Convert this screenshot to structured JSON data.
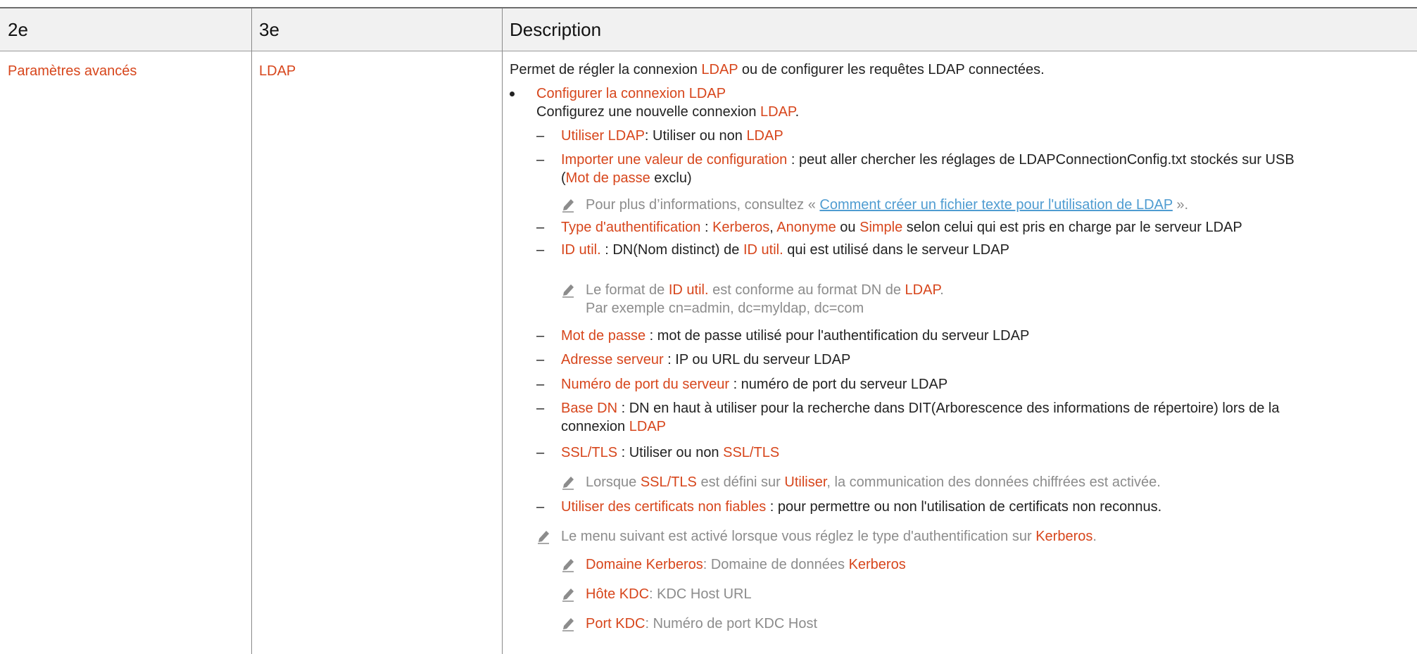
{
  "header": {
    "col1": "2e",
    "col2": "3e",
    "col3": "Description"
  },
  "row": {
    "col1": "Paramètres avancés",
    "col2": "LDAP",
    "intro": {
      "a": "Permet de régler la connexion ",
      "b": "LDAP",
      "c": " ou de configurer les requêtes LDAP connectées."
    },
    "configure": {
      "title": "Configurer la connexion LDAP",
      "sub_a": "Configurez une nouvelle connexion ",
      "sub_b": "LDAP",
      "sub_c": "."
    },
    "items": {
      "use_ldap": {
        "label": "Utiliser LDAP",
        "text_a": ": Utiliser ou non ",
        "text_b": "LDAP"
      },
      "import": {
        "label": "Importer une valeur de configuration",
        "text_a": " : peut aller chercher les réglages de LDAPConnectionConfig.txt stockés sur USB",
        "text_b": "(",
        "text_c": "Mot de passe",
        "text_d": " exclu)"
      },
      "import_note": {
        "a": "Pour plus d’informations, consultez « ",
        "link": "Comment créer un fichier texte pour l'utilisation de LDAP",
        "b": " »."
      },
      "auth_type": {
        "label": "Type d'authentification",
        "a": " : ",
        "kerberos": "Kerberos",
        "b": ", ",
        "anonyme": "Anonyme",
        "c": " ou ",
        "simple": "Simple",
        "d": " selon celui qui est pris en charge par le serveur LDAP"
      },
      "user_id": {
        "label": "ID util.",
        "a": " : DN(Nom distinct) de ",
        "b": "ID util.",
        "c": " qui est utilisé dans le serveur LDAP"
      },
      "user_id_note": {
        "a": "Le format de ",
        "b": "ID util.",
        "c": " est conforme au format DN de ",
        "d": "LDAP",
        "e": ".",
        "example": "Par exemple cn=admin, dc=myldap, dc=com"
      },
      "password": {
        "label": "Mot de passe",
        "text": " : mot de passe utilisé pour l'authentification du serveur LDAP"
      },
      "server_address": {
        "label": "Adresse serveur",
        "text": " : IP ou URL du serveur LDAP"
      },
      "server_port": {
        "label": "Numéro de port du serveur",
        "text": " : numéro de port du serveur LDAP"
      },
      "base_dn": {
        "label": "Base DN",
        "text": " : DN en haut à utiliser pour la recherche dans DIT(Arborescence des informations de répertoire) lors de la",
        "text2": "connexion ",
        "text3": "LDAP"
      },
      "ssl": {
        "label": "SSL/TLS",
        "text_a": " : Utiliser ou non ",
        "text_b": "SSL/TLS"
      },
      "ssl_note": {
        "a": "Lorsque ",
        "b": "SSL/TLS",
        "c": " est défini sur ",
        "d": "Utiliser",
        "e": ", la communication des données chiffrées est activée."
      },
      "untrusted": {
        "label": "Utiliser des certificats non fiables",
        "text": " : pour permettre ou non l'utilisation de certificats non reconnus."
      }
    },
    "kerberos_note": {
      "a": "Le menu suivant est activé lorsque vous réglez le type d'authentification sur ",
      "b": "Kerberos",
      "c": ".",
      "sub": [
        {
          "label": "Domaine Kerberos",
          "a": ": Domaine de données ",
          "b": "Kerberos"
        },
        {
          "label": "Hôte KDC",
          "a": ": KDC Host URL",
          "b": ""
        },
        {
          "label": "Port KDC",
          "a": ": Numéro de port KDC Host",
          "b": ""
        }
      ]
    }
  },
  "colors": {
    "accent": "#d7461c",
    "note_gray": "#8c8c8c",
    "link": "#4f9cd1",
    "header_bg": "#f1f1f1"
  },
  "icons": {
    "note": "pencil-note-icon"
  }
}
